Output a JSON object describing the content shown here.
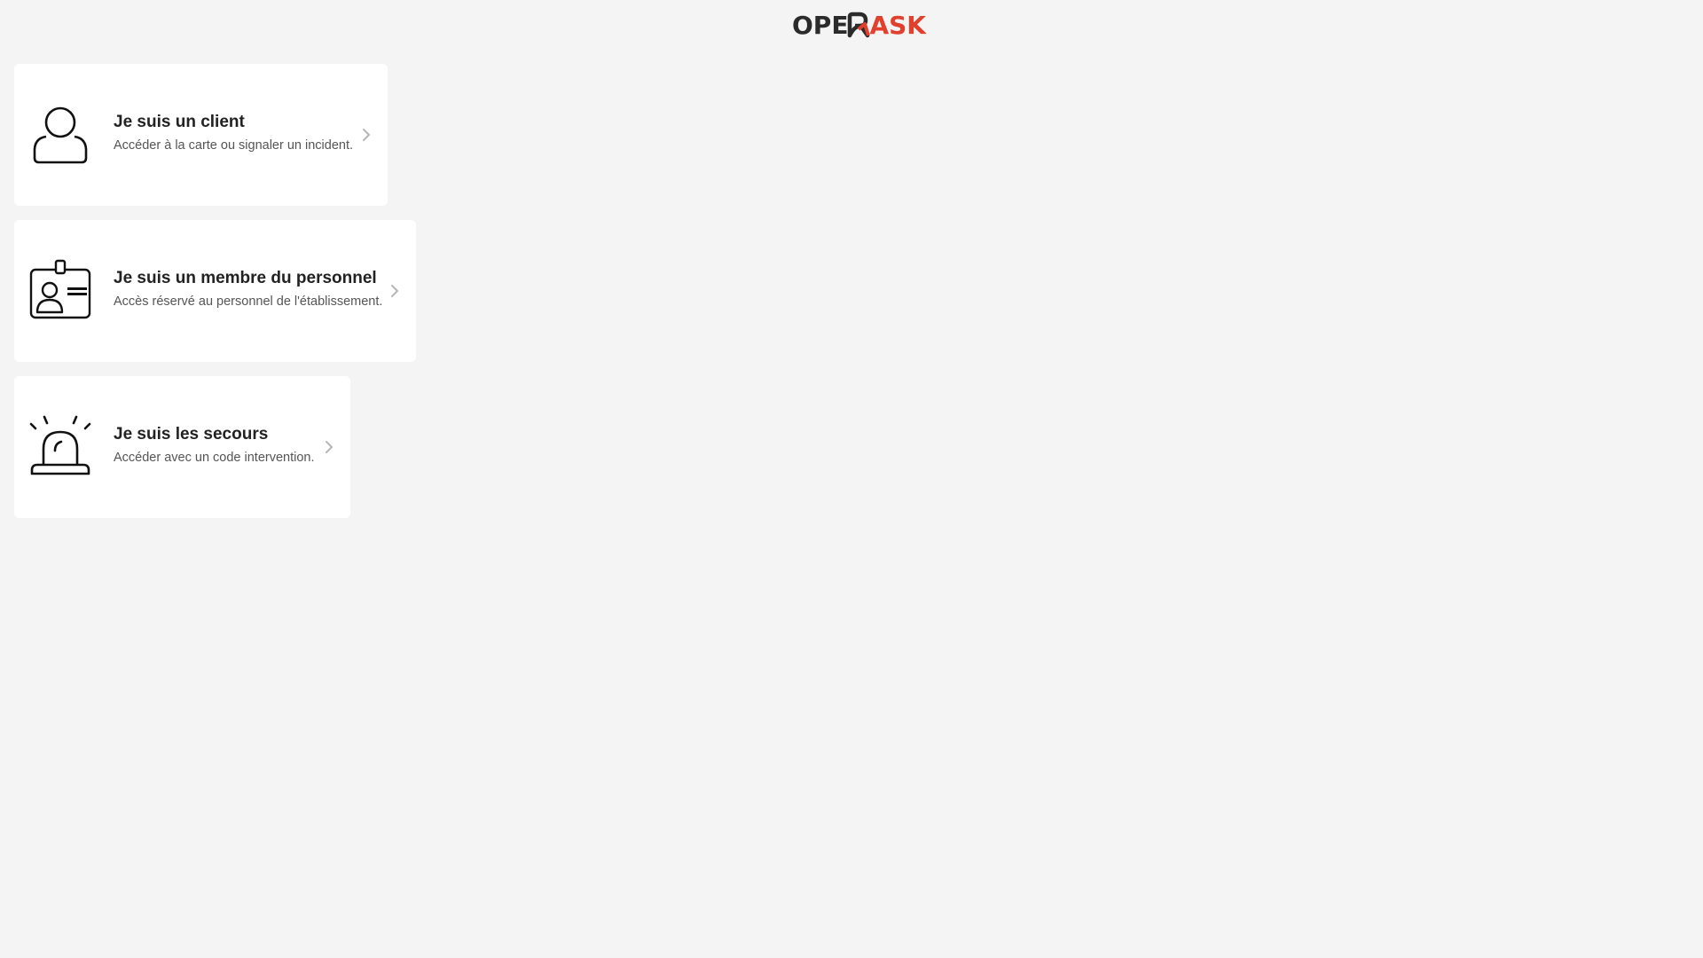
{
  "header": {
    "logo_prefix": "OPE",
    "logo_suffix": "ASK",
    "logo_text": "OPERASK"
  },
  "cards": [
    {
      "title": "Je suis un client",
      "description": "Accéder à la carte ou signaler un incident.",
      "icon": "user-icon"
    },
    {
      "title": "Je suis un membre du personnel",
      "description": "Accès réservé au personnel de l'établissement.",
      "icon": "id-badge-icon"
    },
    {
      "title": "Je suis les secours",
      "description": "Accéder avec un code intervention.",
      "icon": "siren-icon"
    }
  ],
  "colors": {
    "background": "#f4f4f4",
    "card": "#ffffff",
    "logo_dark": "#2b2b2b",
    "logo_accent": "#e0402c",
    "chevron": "#b5b5b5"
  }
}
